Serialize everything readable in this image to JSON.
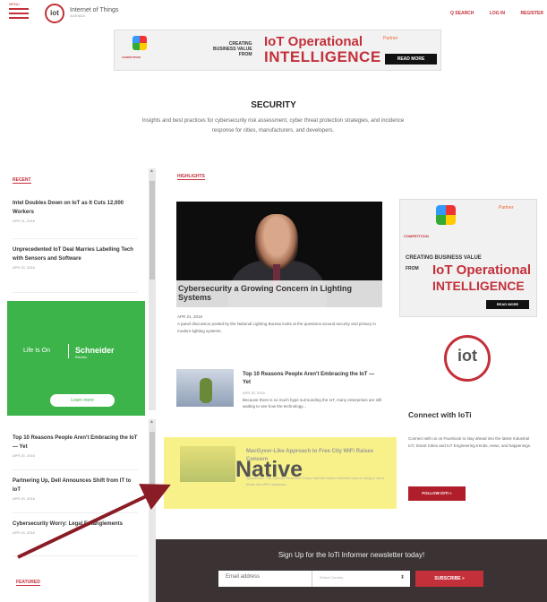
{
  "header": {
    "menu_label": "MENU",
    "logo_text": "iot",
    "brand": "Internet of Things",
    "brand_sub": "AGENDA",
    "links": [
      "Q SEARCH",
      "LOG IN",
      "REGISTER"
    ]
  },
  "banner": {
    "logo_caption": "COMPETITION",
    "creating": "CREATING",
    "business_value": "BUSINESS VALUE",
    "from": "FROM",
    "iot": "IoT Operational",
    "intelligence": "INTELLIGENCE",
    "partner": "Partner",
    "read_more": "READ MORE"
  },
  "section": {
    "title": "SECURITY",
    "description": "Insights and best practices for cybersecurity risk assessment, cyber threat protection strategies, and incidence response for cities, manufacturers, and developers."
  },
  "left": {
    "recent_label": "RECENT",
    "items": [
      {
        "title": "Intel Doubles Down on IoT as It Cuts 12,000 Workers",
        "date": "APR 21, 2016"
      },
      {
        "title": "Unprecedented IoT Deal Marries Labelling Tech with Sensors and Software",
        "date": "APR 20, 2016"
      },
      {
        "title": "Top 10 Reasons People Aren't Embracing the IoT — Yet",
        "date": "APR 20, 2016"
      },
      {
        "title": "Partnering Up, Dell Announces Shift from IT to IoT",
        "date": "APR 20, 2016"
      },
      {
        "title": "Cybersecurity Worry: Legal Entanglements",
        "date": "APR 19, 2016"
      }
    ],
    "ad": {
      "life": "Life Is On",
      "brand": "Schneider",
      "brand_sub": "Electric",
      "cta": "Learn more"
    },
    "featured_label": "FEATURED"
  },
  "center": {
    "highlights_label": "HIGHLIGHTS",
    "video_title": "Cybersecurity a Growing Concern in Lighting Systems",
    "video_date": "APR 21, 2016",
    "video_desc": "A panel discussion posted by the National Lighting Bureau looks at the questions around security and privacy in modern lighting systems.",
    "article": {
      "title": "Top 10 Reasons People Aren't Embracing the IoT — Yet",
      "date": "APR 20, 2016",
      "excerpt": "Because there is so much hype surrounding the IoT, many enterprises are still waiting to see how the technology..."
    },
    "native": {
      "title": "MacGyver-Like Approach to Free City WiFi Raises Concern",
      "excerpt": "Sponsored: The Internet Research Group had the hacker mindset idea of using a cat to break into WiFi networks...",
      "label": "Native"
    }
  },
  "right": {
    "ad": {
      "caption": "COMPETITION",
      "creating": "CREATING BUSINESS VALUE",
      "from": "FROM",
      "iot": "IoT Operational",
      "intelligence": "INTELLIGENCE",
      "read_more": "READ MORE",
      "partner": "Partner"
    },
    "logo_text": "iot",
    "connect_title": "Connect with IoTi",
    "connect_desc": "Connect with us on Facebook to stay ahead into the latest Industrial IoT, Smart Cities and IoT Engineering trends, news, and happenings.",
    "follow_btn": "FOLLOW IOTI »"
  },
  "newsletter": {
    "heading": "Sign Up for the IoTi Informer newsletter today!",
    "email_placeholder": "Email address",
    "select_value": "Select Country",
    "subscribe": "SUBSCRIBE »"
  },
  "colors": {
    "accent": "#c3303a",
    "native_bg": "#f8f18a",
    "schneider_green": "#3db44a",
    "arrow": "#8a1c26"
  }
}
